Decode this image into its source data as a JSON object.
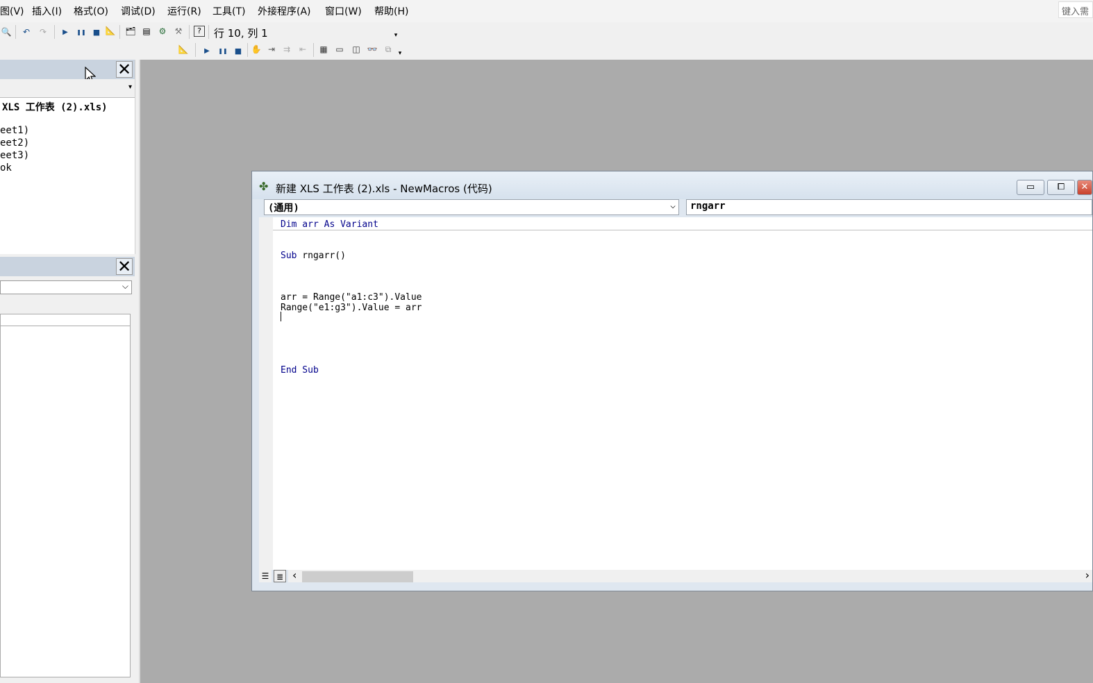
{
  "menu": [
    {
      "id": "view",
      "label": "图(V)"
    },
    {
      "id": "insert",
      "label": "插入(I)"
    },
    {
      "id": "format",
      "label": "格式(O)"
    },
    {
      "id": "debug",
      "label": "调试(D)"
    },
    {
      "id": "run",
      "label": "运行(R)"
    },
    {
      "id": "tools",
      "label": "工具(T)"
    },
    {
      "id": "addins",
      "label": "外接程序(A)"
    },
    {
      "id": "window",
      "label": "窗口(W)"
    },
    {
      "id": "help",
      "label": "帮助(H)"
    }
  ],
  "help_search_placeholder": "键入需",
  "toolbar": {
    "cursor_position": "行 10, 列 1",
    "overflow_glyph": "▾",
    "icons_top": [
      {
        "name": "find-icon",
        "glyph": "🔍"
      },
      {
        "name": "undo-icon",
        "glyph": "↶"
      },
      {
        "name": "redo-icon",
        "glyph": "↷"
      },
      {
        "name": "run-icon",
        "glyph": "▶"
      },
      {
        "name": "break-icon",
        "glyph": "❚❚"
      },
      {
        "name": "reset-icon",
        "glyph": "■"
      },
      {
        "name": "design-mode-icon",
        "glyph": "📐"
      },
      {
        "name": "project-explorer-icon",
        "glyph": "🗂"
      },
      {
        "name": "properties-window-icon",
        "glyph": "▤"
      },
      {
        "name": "object-browser-icon",
        "glyph": "⚙"
      },
      {
        "name": "toolbox-icon",
        "glyph": "⚒"
      },
      {
        "name": "help-icon",
        "glyph": "?"
      }
    ],
    "icons_bottom": [
      {
        "name": "design-mode-icon",
        "glyph": "📐"
      },
      {
        "name": "run-icon",
        "glyph": "▶"
      },
      {
        "name": "break-icon",
        "glyph": "❚❚"
      },
      {
        "name": "reset-icon",
        "glyph": "■"
      },
      {
        "name": "toggle-breakpoint-icon",
        "glyph": "✋"
      },
      {
        "name": "step-into-icon",
        "glyph": "⇥"
      },
      {
        "name": "step-over-icon",
        "glyph": "⇉"
      },
      {
        "name": "step-out-icon",
        "glyph": "⇤"
      },
      {
        "name": "locals-window-icon",
        "glyph": "▦"
      },
      {
        "name": "immediate-window-icon",
        "glyph": "▭"
      },
      {
        "name": "watch-window-icon",
        "glyph": "◫"
      },
      {
        "name": "quick-watch-icon",
        "glyph": "👓"
      },
      {
        "name": "call-stack-icon",
        "glyph": "⧉"
      }
    ]
  },
  "project_pane": {
    "close_glyph": "✕",
    "combo_arrow": "▾",
    "tree": [
      "XLS 工作表 (2).xls)",
      "eet1)",
      "eet2)",
      "eet3)",
      "ok"
    ]
  },
  "properties_pane": {
    "close_glyph": "✕",
    "combo_arrow": "⌵"
  },
  "code_window": {
    "icon_glyph": "✤",
    "title": "新建 XLS 工作表 (2).xls - NewMacros (代码)",
    "minimize_glyph": "▭",
    "maximize_glyph": "⧠",
    "close_glyph": "✕",
    "object_combo": "(通用)",
    "object_combo_arrow": "⌵",
    "procedure_combo": "rngarr",
    "declaration": {
      "kw1": "Dim",
      "mid": " arr ",
      "kw2": "As",
      "kw3": " Variant"
    },
    "sub_header": {
      "kw": "Sub",
      "rest": " rngarr()"
    },
    "line1": "arr = Range(\"a1:c3\").Value",
    "line2": "Range(\"e1:g3\").Value = arr",
    "sub_end": {
      "kw1": "End",
      "kw2": " Sub"
    },
    "procedure_view_glyph": "☰",
    "module_view_glyph": "≣",
    "scroll_left_glyph": "‹",
    "scroll_right_glyph": "›"
  }
}
